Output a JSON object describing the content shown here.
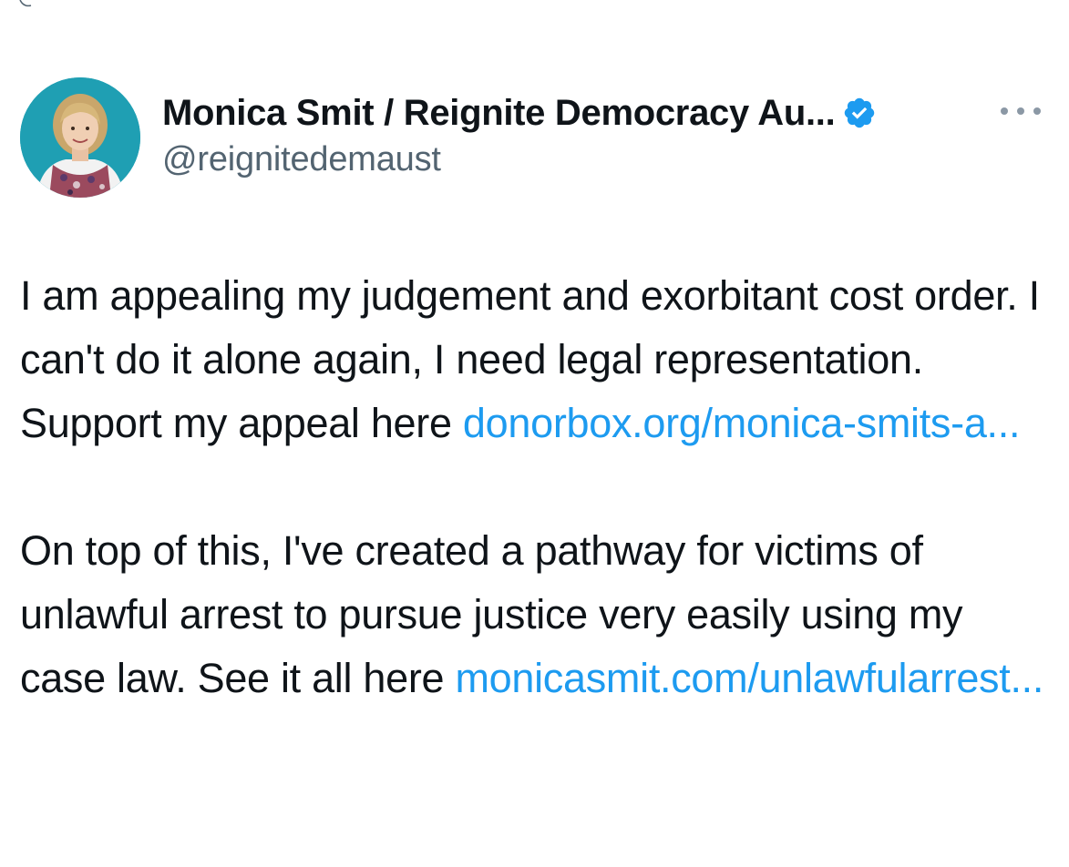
{
  "author": {
    "display_name": "Monica Smit / Reignite Democracy Au...",
    "handle": "@reignitedemaust",
    "verified_icon": "verified-badge-icon",
    "avatar_icon": "avatar-photo"
  },
  "tweet": {
    "paragraph1": {
      "text": "I am appealing my judgement and exorbitant cost order. I can't do it alone again, I need legal representation. Support my appeal here",
      "link": "donorbox.org/monica-smits-a..."
    },
    "paragraph2": {
      "text": "On top of this, I've created a pathway for victims of unlawful arrest to pursue justice very easily using my case law. See it all here",
      "link": "monicasmit.com/unlawfularrest..."
    }
  },
  "colors": {
    "link": "#1d9bf0",
    "handle": "#536471",
    "text": "#0f1419",
    "verified": "#1d9bf0"
  },
  "menu_icon": "more-dots-icon"
}
